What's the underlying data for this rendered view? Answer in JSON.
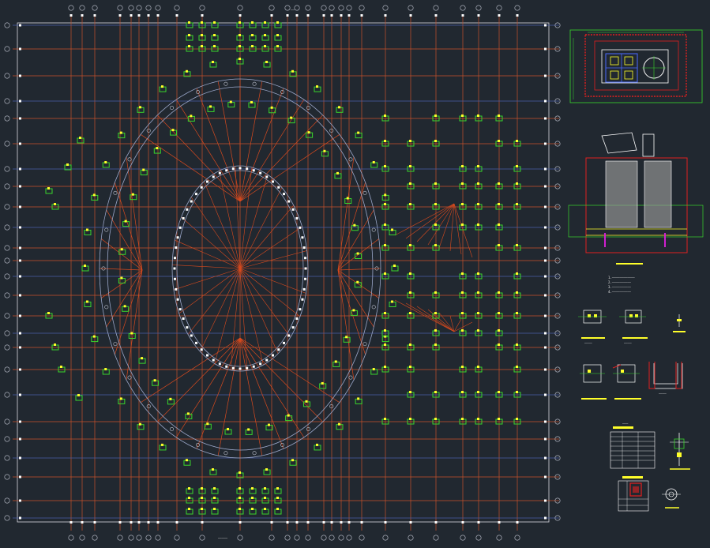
{
  "drawing": {
    "background": "#212830",
    "colors": {
      "frame": "#d8d8e0",
      "grid_line": "#c8502a",
      "grid_line_blue": "#4a5fa8",
      "bubble": "#c0c4d0",
      "pile_cap": "#39d62c",
      "pile_mark": "#ffff2a",
      "ring": "#9aa6c8",
      "spoke": "#d84a1e",
      "white_mark": "#ffffff",
      "detail_red": "#e02020",
      "detail_magenta": "#d020d0",
      "hatch": "#9a9a9a"
    }
  },
  "plan": {
    "title_bottom": "—————",
    "north_label": "——"
  },
  "details": {
    "notes_lines": [
      "1.————————————",
      "2.——————————",
      "3.——————————",
      "4.——————————"
    ],
    "caption_1": "————",
    "caption_2": "————",
    "caption_3": "————",
    "table_title": "———"
  }
}
